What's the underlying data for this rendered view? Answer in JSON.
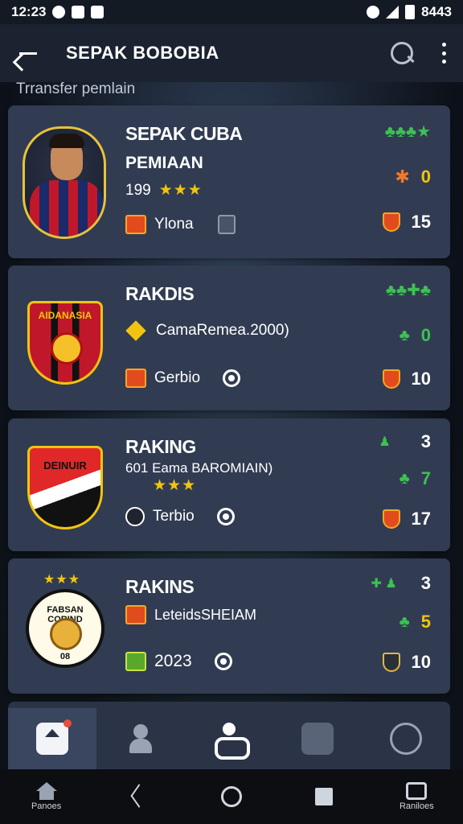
{
  "status_bar": {
    "time": "12:23",
    "right_text": "8443"
  },
  "app_bar": {
    "title": "SEPAK BOBOBIA"
  },
  "subtitle": "Trransfer pemlain",
  "cards": [
    {
      "name": "SEPAK CUBA",
      "subtitle": "PEMIAAN",
      "rating_number": "199",
      "stars": "★★★",
      "row_label": "Ylona",
      "right_icons": "♣♣♣★",
      "stat_top": "0",
      "stat_bottom": "15"
    },
    {
      "name": "RAKDIS",
      "crest_label": "AIDANASIA",
      "subtitle": "CamaRemea.2000)",
      "row_label": "Gerbio",
      "right_icons": "♣♣✚♣",
      "stat_top": "0",
      "stat_bottom": "10"
    },
    {
      "name": "RAKING",
      "crest_label": "DEINUIR",
      "subtitle": "601 Eama BAROMIAIN)",
      "stars": "★★★",
      "row_label": "Terbio",
      "right_top_num": "3",
      "stat_top": "7",
      "stat_bottom": "17"
    },
    {
      "name": "RAKINS",
      "crest_label": "FABSAN CORIND",
      "crest_stars": "★★★",
      "crest_bottom": "08",
      "subtitle": "LeteidsSHEIAM",
      "row_label": "2023",
      "right_top_num": "3",
      "stat_top": "5",
      "stat_bottom": "10"
    }
  ],
  "sys_nav": {
    "left_label": "Panoes",
    "right_label": "Raniloes"
  },
  "colors": {
    "accent_yellow": "#f1c40f",
    "accent_green": "#3cc251",
    "card_bg": "#313c52"
  }
}
